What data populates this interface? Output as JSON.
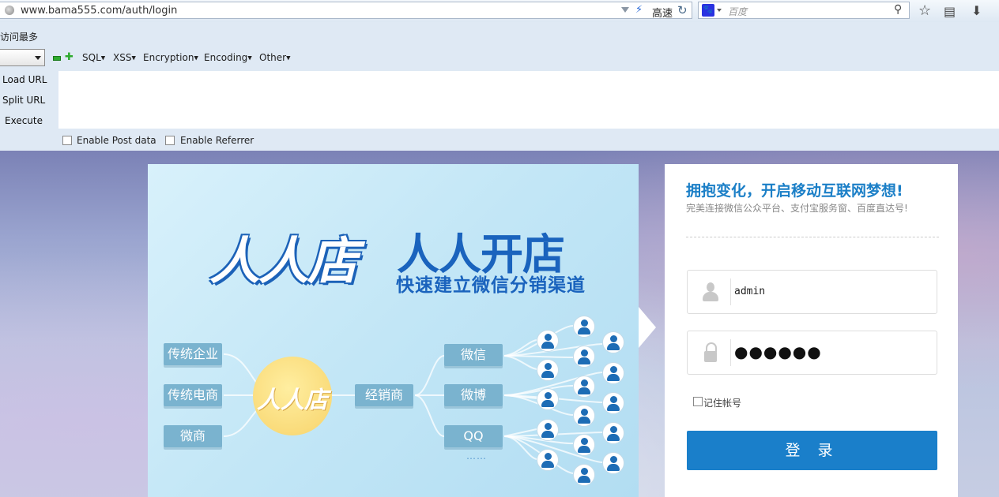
{
  "browser": {
    "url": "www.bama555.com/auth/login",
    "speed_label": "高速",
    "search_placeholder": "百度"
  },
  "hackbar": {
    "most_visited": "访问最多",
    "menus": [
      "SQL",
      "XSS",
      "Encryption",
      "Encoding",
      "Other"
    ],
    "actions": [
      "Load URL",
      "Split URL",
      "Execute"
    ],
    "checkboxes": [
      "Enable Post data",
      "Enable Referrer"
    ]
  },
  "banner": {
    "logo_main": "人人店",
    "logo_secondary": "人人开店",
    "logo_subtitle": "快速建立微信分销渠道",
    "left_tags": [
      "传统企业",
      "传统电商",
      "微商"
    ],
    "center_label": "人人店",
    "middle_tag": "经销商",
    "right_tags": [
      "微信",
      "微博",
      "QQ"
    ],
    "ellipsis": "……"
  },
  "login": {
    "title": "拥抱变化，开启移动互联网梦想!",
    "subtitle": "完美连接微信公众平台、支付宝服务窗、百度直达号!",
    "username": "admin",
    "password_mask": "●●●●●●",
    "remember_label": "记住帐号",
    "submit_label": "登 录"
  },
  "colors": {
    "brand_blue": "#1a7fca",
    "tag_blue": "#7ab3cf",
    "logo_blue": "#1a63bd"
  }
}
